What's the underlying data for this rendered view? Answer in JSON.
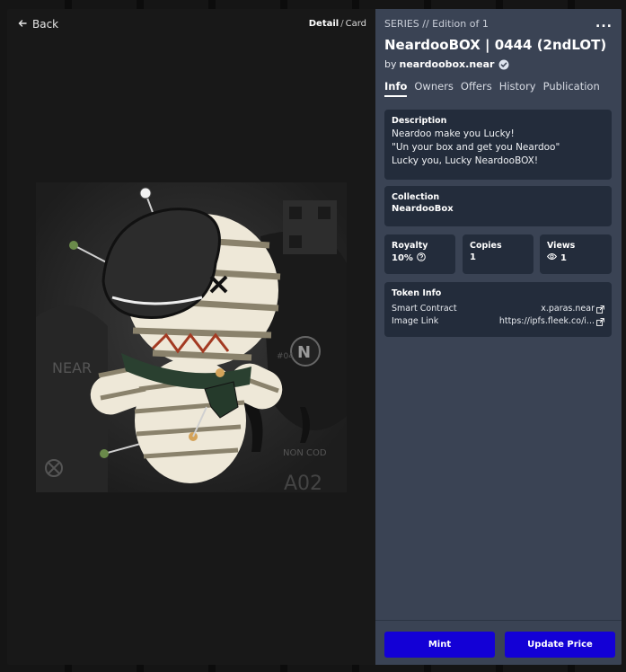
{
  "nav": {
    "back_label": "Back",
    "view_active": "Detail",
    "view_separator": "/",
    "view_other": "Card"
  },
  "token": {
    "series_label": "SERIES // Edition of 1",
    "title": "NeardooBOX | 0444 (2ndLOT)",
    "by_prefix": "by",
    "creator": "neardoobox.near",
    "more_label": "..."
  },
  "tabs": [
    {
      "label": "Info",
      "active": true
    },
    {
      "label": "Owners"
    },
    {
      "label": "Offers"
    },
    {
      "label": "History"
    },
    {
      "label": "Publication"
    }
  ],
  "description": {
    "label": "Description",
    "lines": [
      "Neardoo make you Lucky!",
      "\"Un your box and get you Neardoo\"",
      "Lucky you, Lucky NeardooBOX!"
    ]
  },
  "collection": {
    "label": "Collection",
    "value": "NeardooBox"
  },
  "stats": {
    "royalty_label": "Royalty",
    "royalty_value": "10%",
    "copies_label": "Copies",
    "copies_value": "1",
    "views_label": "Views",
    "views_value": "1"
  },
  "token_info": {
    "label": "Token Info",
    "contract_label": "Smart Contract",
    "contract_value": "x.paras.near",
    "image_label": "Image Link",
    "image_value": "https://ipfs.fleek.co/i..."
  },
  "actions": {
    "mint_label": "Mint",
    "update_price_label": "Update Price"
  },
  "colors": {
    "panel": "#3a4354",
    "card": "#232c3b",
    "button": "#1300d6",
    "left_pane": "#181818"
  },
  "artwork_lettering": [
    "NEAR",
    "N",
    "#04",
    "A02",
    "NON COD"
  ]
}
